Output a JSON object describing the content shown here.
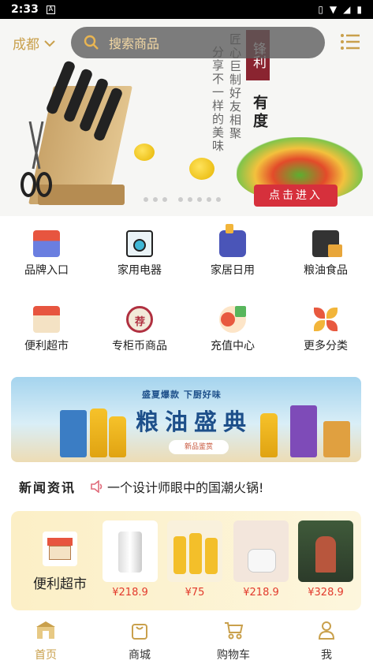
{
  "status_bar": {
    "time": "2:33",
    "notification": "A"
  },
  "header": {
    "city": "成都",
    "search_placeholder": "搜索商品"
  },
  "banner": {
    "vertical_text_1": "匠心巨制好友相聚",
    "vertical_text_2": "分享不一样的美味",
    "brand": "锋利",
    "brand_dot": "·",
    "brand_sub": "有度",
    "cta_label": "点击进入"
  },
  "categories": [
    {
      "label": "品牌入口",
      "icon": "brand-store-icon"
    },
    {
      "label": "家用电器",
      "icon": "washing-machine-icon"
    },
    {
      "label": "家居日用",
      "icon": "household-icon"
    },
    {
      "label": "粮油食品",
      "icon": "grain-oil-icon"
    },
    {
      "label": "便利超市",
      "icon": "convenience-store-icon"
    },
    {
      "label": "专柜币商品",
      "icon": "recommend-badge-icon"
    },
    {
      "label": "充值中心",
      "icon": "recharge-icon"
    },
    {
      "label": "更多分类",
      "icon": "more-categories-icon"
    }
  ],
  "promo": {
    "subtitle": "盛夏爆款  下厨好味",
    "title": "粮油盛典",
    "tag": "新品鉴赏"
  },
  "news": {
    "title": "新闻资讯",
    "headline": "一个设计师眼中的国潮火锅!"
  },
  "mart": {
    "label": "便利超市",
    "products": [
      {
        "price": "¥218.9",
        "name": "kettle"
      },
      {
        "price": "¥75",
        "name": "cooking-oil"
      },
      {
        "price": "¥218.9",
        "name": "rice-cooker"
      },
      {
        "price": "¥328.9",
        "name": "tea-set"
      }
    ]
  },
  "tabs": [
    {
      "label": "首页",
      "icon": "home-icon",
      "active": true
    },
    {
      "label": "商城",
      "icon": "mall-bag-icon",
      "active": false
    },
    {
      "label": "购物车",
      "icon": "cart-icon",
      "active": false
    },
    {
      "label": "我",
      "icon": "profile-icon",
      "active": false
    }
  ],
  "colors": {
    "accent": "#c9a04c",
    "price": "#e23a2c",
    "cta": "#d6303c"
  }
}
